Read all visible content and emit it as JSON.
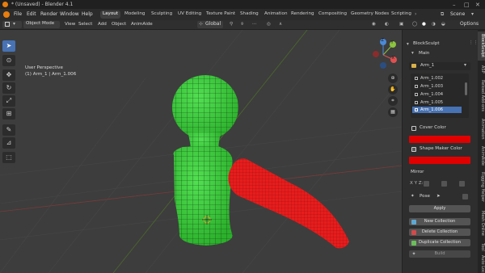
{
  "window": {
    "title": "* (Unsaved) - Blender 4.1"
  },
  "menu": [
    "File",
    "Edit",
    "Render",
    "Window",
    "Help"
  ],
  "workspaces": [
    "Layout",
    "Modeling",
    "Sculpting",
    "UV Editing",
    "Texture Paint",
    "Shading",
    "Animation",
    "Rendering",
    "Compositing",
    "Geometry Nodes",
    "Scripting"
  ],
  "active_workspace": "Layout",
  "scene_label": "Scene",
  "header": {
    "mode": "Object Mode",
    "items": [
      "View",
      "Select",
      "Add",
      "Object",
      "AnimAide"
    ],
    "transform": "Global",
    "options": "Options"
  },
  "viewport": {
    "perspective": "User Perspective",
    "object_info": "(1) Arm_1 | Arm_1.006"
  },
  "gizmo": {
    "y": "Y",
    "x": "X",
    "z": "Z"
  },
  "panel": {
    "addon_title": "BlockSculpt",
    "main_label": "Main",
    "collection_selected": "Arm_1",
    "objects": [
      "Arm_1.002",
      "Arm_1.003",
      "Arm_1.004",
      "Arm_1.005",
      "Arm_1.006"
    ],
    "selected_object": "Arm_1.006",
    "cover_color_label": "Cover Color",
    "cover_color": "#e00000",
    "shape_maker_color_label": "Shape Maker Color",
    "shape_maker_color": "#e00000",
    "mirror_label": "Mirror",
    "mirror_axes": "X Y Z:",
    "pose_label": "Pose",
    "apply_label": "Apply",
    "new_collection_label": "New Collection",
    "delete_collection_label": "Delete Collection",
    "duplicate_collection_label": "Duplicate Collection",
    "build_label": "Build"
  },
  "side_tabs": [
    "BlockSculpt",
    "ASP",
    "Reload Add-ons",
    "Animation",
    "AnimAide",
    "Rigging Helper",
    "Mesh Online",
    "Tool",
    "Auto Locate"
  ],
  "colors": {
    "accent": "#4772b3",
    "body_green": "#3ecb3e",
    "arm_red": "#e81c1c",
    "viewport_bg": "#3d3d3d"
  }
}
